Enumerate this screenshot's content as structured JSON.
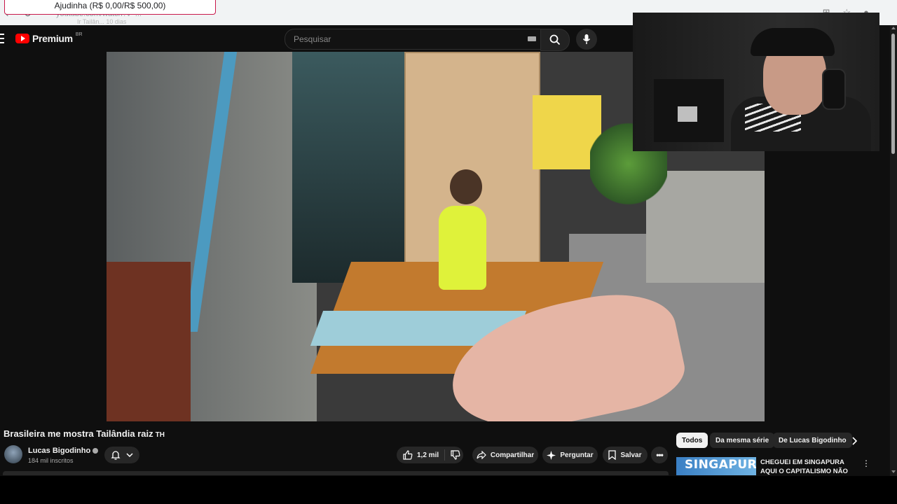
{
  "browser": {
    "url": "youtube.com/watch?v=...",
    "url_hint": "Ir Tailân... 10 dias",
    "donation_text": "Ajudinha (R$ 0,00/R$ 500,00)"
  },
  "header": {
    "logo_text": "Premium",
    "logo_region": "BR",
    "search_placeholder": "Pesquisar"
  },
  "video": {
    "title": "Brasileira me mostra Tailândia raiz",
    "title_lang": "TH"
  },
  "channel": {
    "name": "Lucas Bigodinho",
    "subscribers": "184 mil inscritos"
  },
  "actions": {
    "likes": "1,2 mil",
    "share_label": "Compartilhar",
    "ask_label": "Perguntar",
    "save_label": "Salvar"
  },
  "chips": [
    "Todos",
    "Da mesma série",
    "De Lucas Bigodinho"
  ],
  "recommended": [
    {
      "thumb_text": "SINGAPURA",
      "title": "CHEGUEI EM SINGAPURA AQUI O CAPITALISMO NÃO TEM ..."
    }
  ],
  "colors": {
    "background": "#0f0f0f",
    "brand_red": "#ff0000",
    "chip_active": "#f1f1f1"
  },
  "icons": [
    "menu-icon",
    "youtube-logo-icon",
    "keyboard-icon",
    "search-icon",
    "mic-icon",
    "bell-icon",
    "chevron-down-icon",
    "thumbs-up-icon",
    "thumbs-down-icon",
    "share-icon",
    "sparkle-icon",
    "bookmark-icon",
    "more-icon",
    "chevron-right-icon",
    "verified-icon"
  ]
}
